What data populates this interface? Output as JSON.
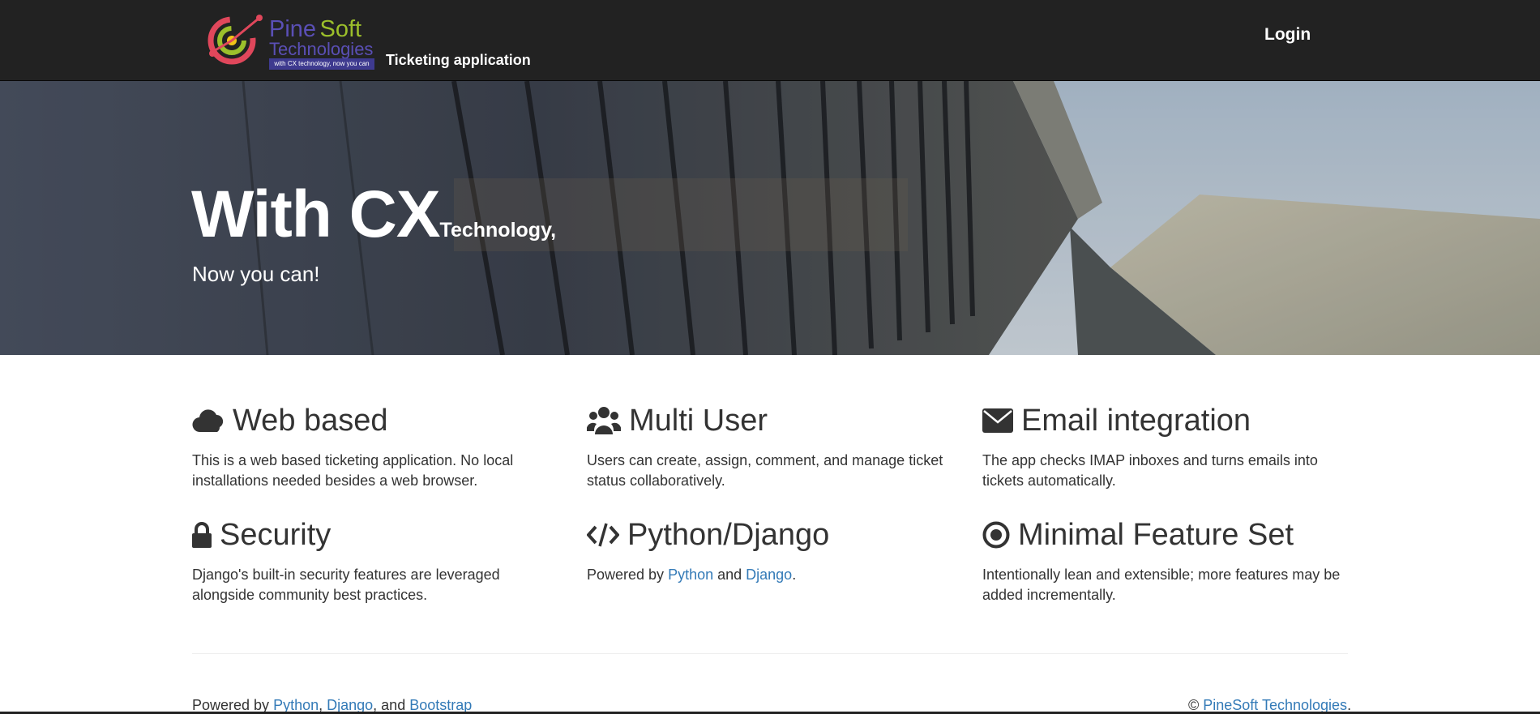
{
  "navbar": {
    "brand_pine": "Pine",
    "brand_soft": "Soft",
    "brand_tech": "Technologies",
    "brand_tagline": "with CX technology, now you can",
    "app_name": "Ticketing application",
    "login_label": "Login"
  },
  "hero": {
    "title_big": "With CX",
    "title_small": "Technology,",
    "subtitle": "Now you can!"
  },
  "features": [
    {
      "icon": "cloud-icon",
      "title": "Web based",
      "text": "This is a web based ticketing application. No local installations needed besides a web browser."
    },
    {
      "icon": "users-icon",
      "title": "Multi User",
      "text": "Users can create, assign, comment, and manage ticket status collaboratively."
    },
    {
      "icon": "envelope-icon",
      "title": "Email integration",
      "text": "The app checks IMAP inboxes and turns emails into tickets automatically."
    },
    {
      "icon": "lock-icon",
      "title": "Security",
      "text": "Django's built-in security features are leveraged alongside community best practices."
    },
    {
      "icon": "code-icon",
      "title": "Python/Django",
      "text_prefix": "Powered by ",
      "link1": "Python",
      "text_mid": " and ",
      "link2": "Django",
      "text_suffix": "."
    },
    {
      "icon": "bullseye-icon",
      "title": "Minimal Feature Set",
      "text": "Intentionally lean and extensible; more features may be added incrementally."
    }
  ],
  "footer": {
    "prefix": "Powered by ",
    "link_python": "Python",
    "sep1": ", ",
    "link_django": "Django",
    "sep2": ", and ",
    "link_bootstrap": "Bootstrap",
    "copyright_symbol": "© ",
    "link_company": "PineSoft Technologies",
    "copyright_suffix": "."
  },
  "colors": {
    "navbar_bg": "#222222",
    "link": "#337ab7",
    "text": "#333333"
  }
}
